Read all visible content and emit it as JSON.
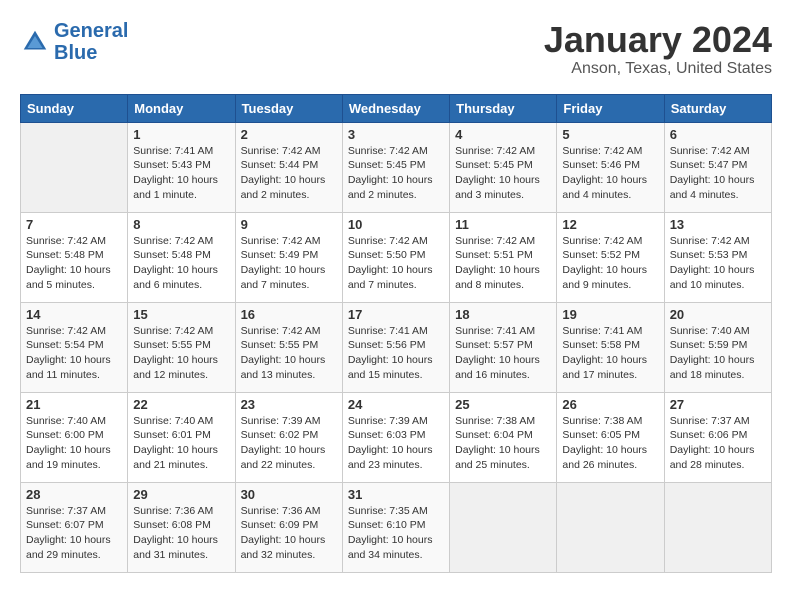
{
  "header": {
    "logo_line1": "General",
    "logo_line2": "Blue",
    "month_year": "January 2024",
    "location": "Anson, Texas, United States"
  },
  "weekdays": [
    "Sunday",
    "Monday",
    "Tuesday",
    "Wednesday",
    "Thursday",
    "Friday",
    "Saturday"
  ],
  "weeks": [
    [
      {
        "day": "",
        "info": ""
      },
      {
        "day": "1",
        "info": "Sunrise: 7:41 AM\nSunset: 5:43 PM\nDaylight: 10 hours\nand 1 minute."
      },
      {
        "day": "2",
        "info": "Sunrise: 7:42 AM\nSunset: 5:44 PM\nDaylight: 10 hours\nand 2 minutes."
      },
      {
        "day": "3",
        "info": "Sunrise: 7:42 AM\nSunset: 5:45 PM\nDaylight: 10 hours\nand 2 minutes."
      },
      {
        "day": "4",
        "info": "Sunrise: 7:42 AM\nSunset: 5:45 PM\nDaylight: 10 hours\nand 3 minutes."
      },
      {
        "day": "5",
        "info": "Sunrise: 7:42 AM\nSunset: 5:46 PM\nDaylight: 10 hours\nand 4 minutes."
      },
      {
        "day": "6",
        "info": "Sunrise: 7:42 AM\nSunset: 5:47 PM\nDaylight: 10 hours\nand 4 minutes."
      }
    ],
    [
      {
        "day": "7",
        "info": "Sunrise: 7:42 AM\nSunset: 5:48 PM\nDaylight: 10 hours\nand 5 minutes."
      },
      {
        "day": "8",
        "info": "Sunrise: 7:42 AM\nSunset: 5:48 PM\nDaylight: 10 hours\nand 6 minutes."
      },
      {
        "day": "9",
        "info": "Sunrise: 7:42 AM\nSunset: 5:49 PM\nDaylight: 10 hours\nand 7 minutes."
      },
      {
        "day": "10",
        "info": "Sunrise: 7:42 AM\nSunset: 5:50 PM\nDaylight: 10 hours\nand 7 minutes."
      },
      {
        "day": "11",
        "info": "Sunrise: 7:42 AM\nSunset: 5:51 PM\nDaylight: 10 hours\nand 8 minutes."
      },
      {
        "day": "12",
        "info": "Sunrise: 7:42 AM\nSunset: 5:52 PM\nDaylight: 10 hours\nand 9 minutes."
      },
      {
        "day": "13",
        "info": "Sunrise: 7:42 AM\nSunset: 5:53 PM\nDaylight: 10 hours\nand 10 minutes."
      }
    ],
    [
      {
        "day": "14",
        "info": "Sunrise: 7:42 AM\nSunset: 5:54 PM\nDaylight: 10 hours\nand 11 minutes."
      },
      {
        "day": "15",
        "info": "Sunrise: 7:42 AM\nSunset: 5:55 PM\nDaylight: 10 hours\nand 12 minutes."
      },
      {
        "day": "16",
        "info": "Sunrise: 7:42 AM\nSunset: 5:55 PM\nDaylight: 10 hours\nand 13 minutes."
      },
      {
        "day": "17",
        "info": "Sunrise: 7:41 AM\nSunset: 5:56 PM\nDaylight: 10 hours\nand 15 minutes."
      },
      {
        "day": "18",
        "info": "Sunrise: 7:41 AM\nSunset: 5:57 PM\nDaylight: 10 hours\nand 16 minutes."
      },
      {
        "day": "19",
        "info": "Sunrise: 7:41 AM\nSunset: 5:58 PM\nDaylight: 10 hours\nand 17 minutes."
      },
      {
        "day": "20",
        "info": "Sunrise: 7:40 AM\nSunset: 5:59 PM\nDaylight: 10 hours\nand 18 minutes."
      }
    ],
    [
      {
        "day": "21",
        "info": "Sunrise: 7:40 AM\nSunset: 6:00 PM\nDaylight: 10 hours\nand 19 minutes."
      },
      {
        "day": "22",
        "info": "Sunrise: 7:40 AM\nSunset: 6:01 PM\nDaylight: 10 hours\nand 21 minutes."
      },
      {
        "day": "23",
        "info": "Sunrise: 7:39 AM\nSunset: 6:02 PM\nDaylight: 10 hours\nand 22 minutes."
      },
      {
        "day": "24",
        "info": "Sunrise: 7:39 AM\nSunset: 6:03 PM\nDaylight: 10 hours\nand 23 minutes."
      },
      {
        "day": "25",
        "info": "Sunrise: 7:38 AM\nSunset: 6:04 PM\nDaylight: 10 hours\nand 25 minutes."
      },
      {
        "day": "26",
        "info": "Sunrise: 7:38 AM\nSunset: 6:05 PM\nDaylight: 10 hours\nand 26 minutes."
      },
      {
        "day": "27",
        "info": "Sunrise: 7:37 AM\nSunset: 6:06 PM\nDaylight: 10 hours\nand 28 minutes."
      }
    ],
    [
      {
        "day": "28",
        "info": "Sunrise: 7:37 AM\nSunset: 6:07 PM\nDaylight: 10 hours\nand 29 minutes."
      },
      {
        "day": "29",
        "info": "Sunrise: 7:36 AM\nSunset: 6:08 PM\nDaylight: 10 hours\nand 31 minutes."
      },
      {
        "day": "30",
        "info": "Sunrise: 7:36 AM\nSunset: 6:09 PM\nDaylight: 10 hours\nand 32 minutes."
      },
      {
        "day": "31",
        "info": "Sunrise: 7:35 AM\nSunset: 6:10 PM\nDaylight: 10 hours\nand 34 minutes."
      },
      {
        "day": "",
        "info": ""
      },
      {
        "day": "",
        "info": ""
      },
      {
        "day": "",
        "info": ""
      }
    ]
  ]
}
